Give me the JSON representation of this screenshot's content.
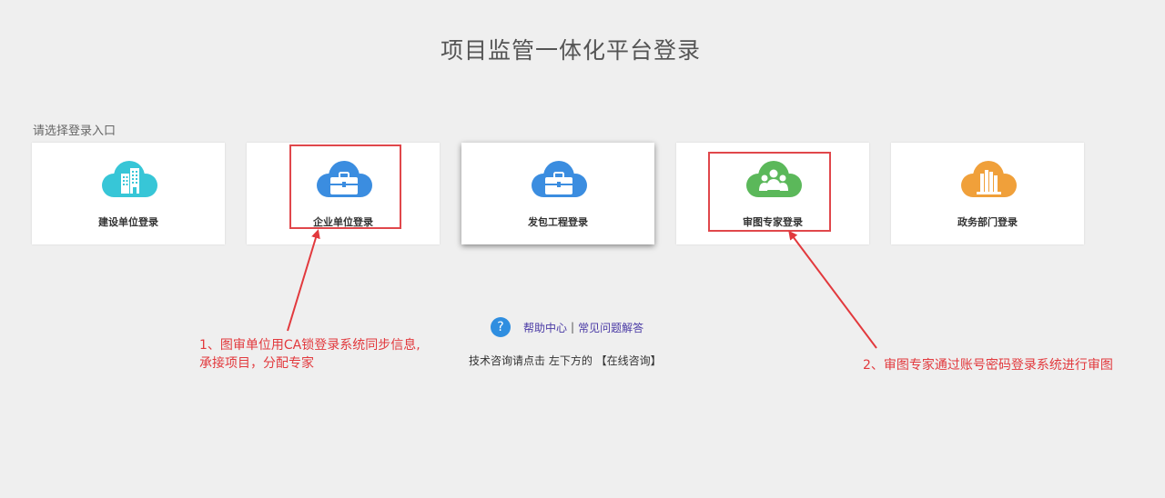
{
  "page": {
    "title": "项目监管一体化平台登录",
    "subtitle": "请选择登录入口"
  },
  "cards": [
    {
      "label": "建设单位登录",
      "icon": "building-cloud-icon",
      "color": "#37c6d7"
    },
    {
      "label": "企业单位登录",
      "icon": "briefcase-cloud-icon",
      "color": "#3b8de0"
    },
    {
      "label": "发包工程登录",
      "icon": "briefcase-cloud-icon",
      "color": "#3b8de0"
    },
    {
      "label": "审图专家登录",
      "icon": "people-cloud-icon",
      "color": "#5bb85a"
    },
    {
      "label": "政务部门登录",
      "icon": "books-cloud-icon",
      "color": "#f0a03a"
    }
  ],
  "help": {
    "icon": "question-icon",
    "icon_glyph": "?",
    "help_center": "帮助中心",
    "separator": "|",
    "faq": "常见问题解答",
    "consult": "技术咨询请点击 左下方的 【在线咨询】"
  },
  "annotations": {
    "note1_line1": "1、图审单位用CA锁登录系统同步信息,",
    "note1_line2": "承接项目，分配专家",
    "note2": "2、审图专家通过账号密码登录系统进行审图",
    "color": "#e2393d"
  }
}
